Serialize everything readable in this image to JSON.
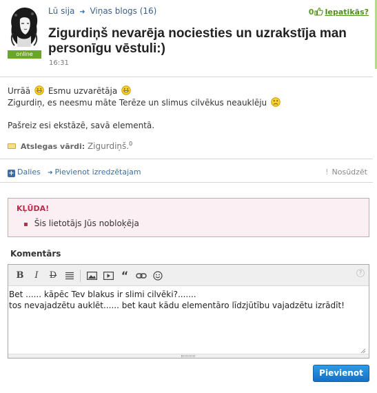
{
  "post": {
    "author": "Lū sija",
    "blog_link": "Viņas blogs (16)",
    "title": "Zigurdiņš nevarēja nociesties un uzrakstīja man personīgu vēstuli:)",
    "time": "16:31",
    "status_badge": "online",
    "like_count": "0",
    "like_label": "Iepatikās?"
  },
  "content": {
    "line1_a": "Urrāā",
    "line1_b": "Esmu uzvarētāja",
    "line2": "Zigurdiņ, es neesmu māte Terēze un slimus cilvēkus neauklēju",
    "line3": "Pašreiz esi ekstāzē, savā elementā.",
    "smileys": [
      "grin-smiley-icon",
      "grin-smiley-icon",
      "sad-smiley-icon"
    ]
  },
  "keywords": {
    "label": "Atslegas vārdi:",
    "value": "Zigurdiņš.",
    "count": "0"
  },
  "actions": {
    "share": "Dalies",
    "add_to_favorites": "Pievienot izredzētajam",
    "report": "Nosūdzēt"
  },
  "error": {
    "title": "KĻŪDA!",
    "message": "Šis lietotājs Jūs nobloķēja"
  },
  "comment": {
    "label": "Komentārs",
    "text": "Bet ...... kāpēc Tev blakus ir slimi cilvēki?.......\ntos nevajadzētu auklēt...... bet kaut kādu elementāro līdzjūtību vajadzētu izrādīt!",
    "submit_label": "Pievienot",
    "toolbar": {
      "bold": "B",
      "italic": "I",
      "strike": "D",
      "help": "?"
    }
  },
  "colors": {
    "accent_green": "#6aa629",
    "link_blue": "#3a6ea5",
    "error_red": "#c0284b",
    "button_blue": "#1f86d6"
  }
}
